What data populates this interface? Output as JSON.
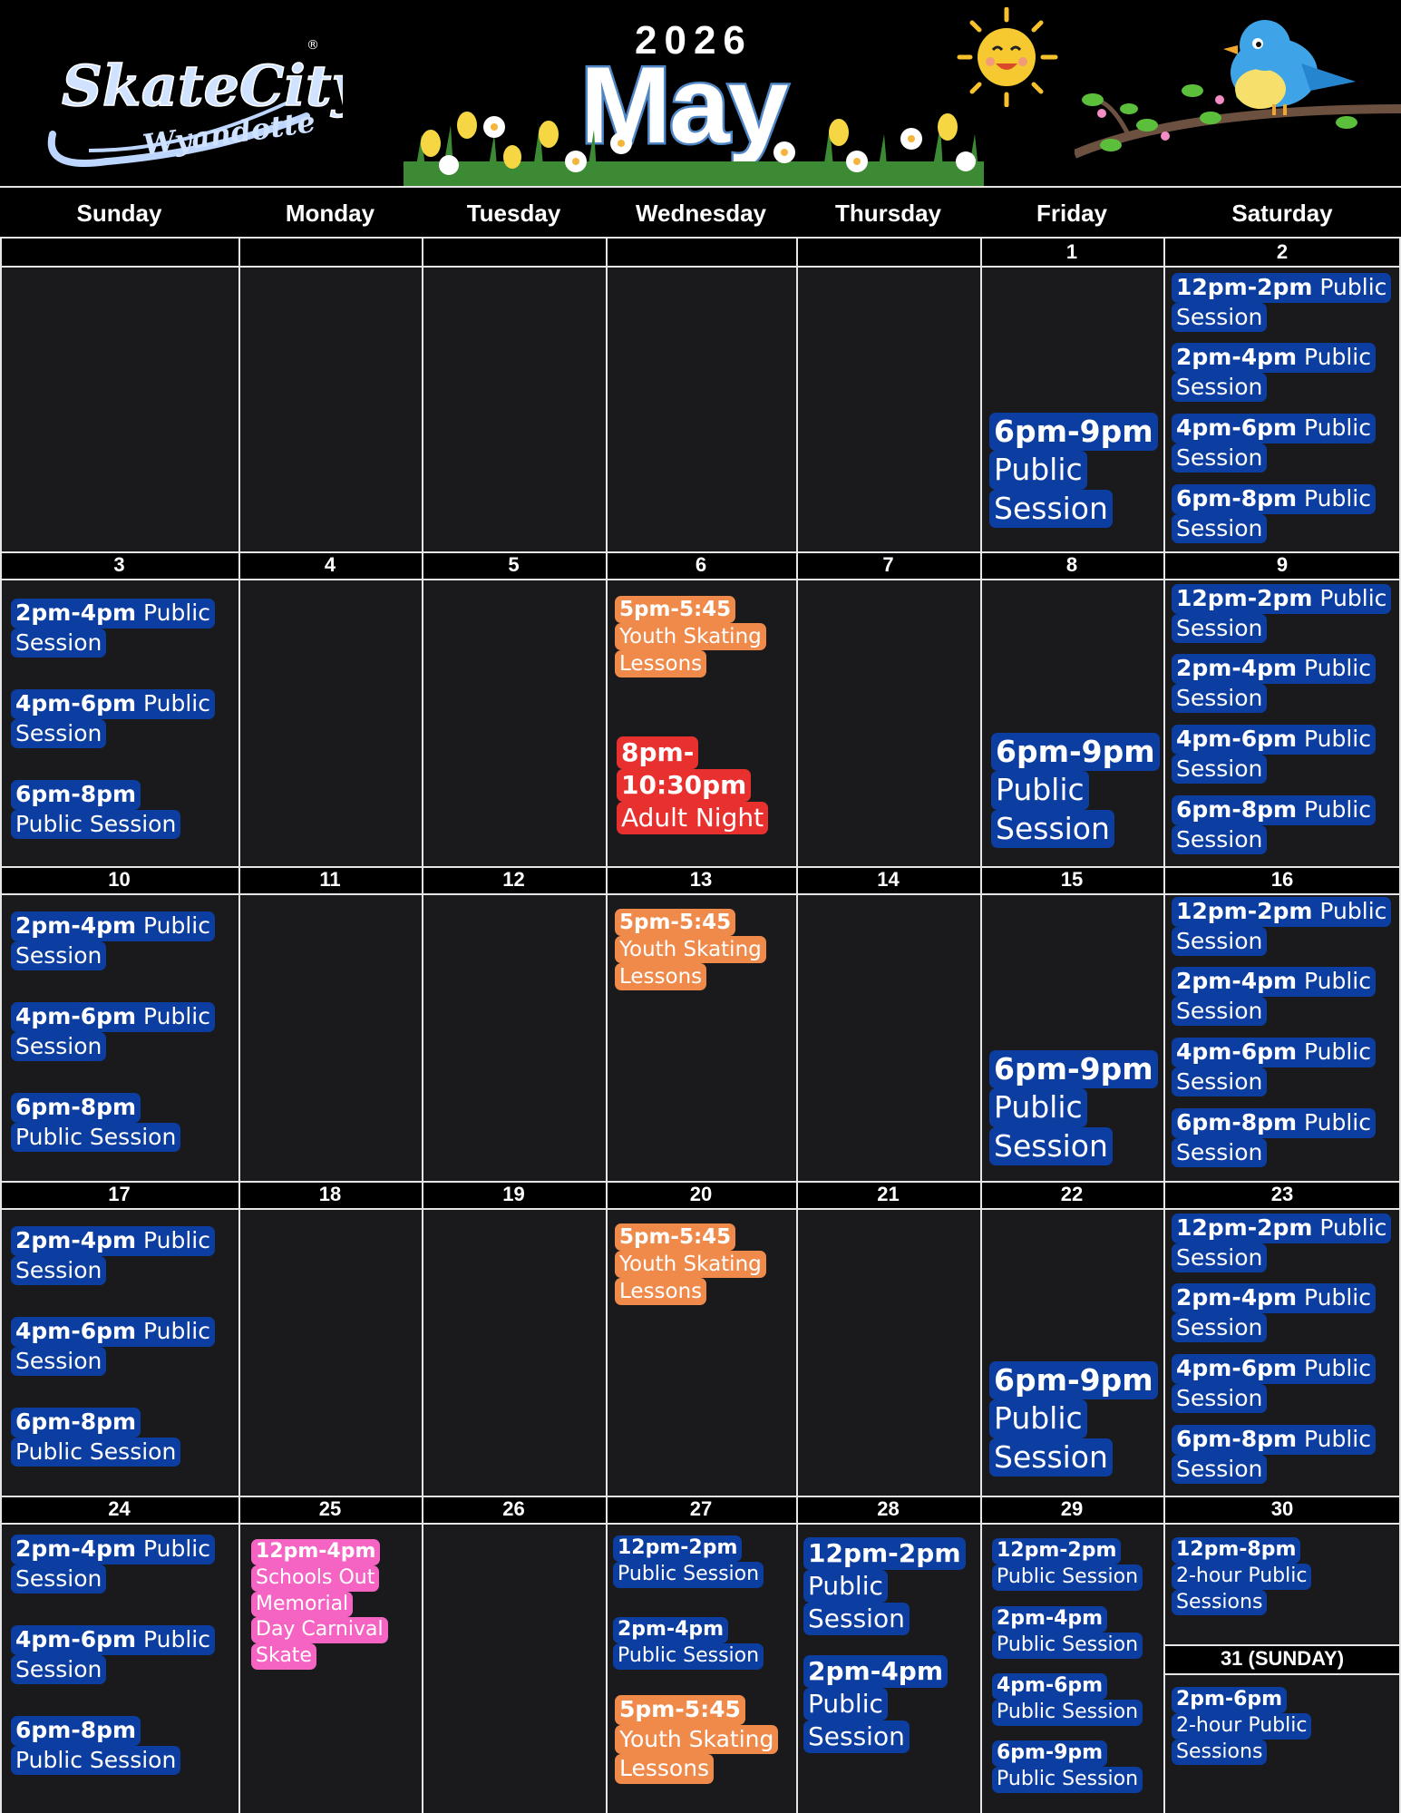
{
  "brand": {
    "name": "SkateCity",
    "location": "Wyandotte",
    "registered": "®"
  },
  "calendar": {
    "year": "2026",
    "month": "May"
  },
  "weekdays": [
    "Sunday",
    "Monday",
    "Tuesday",
    "Wednesday",
    "Thursday",
    "Friday",
    "Saturday"
  ],
  "weeks": [
    {
      "days": [
        "",
        "",
        "",
        "",
        "",
        "1",
        "2"
      ]
    },
    {
      "days": [
        "3",
        "4",
        "5",
        "6",
        "7",
        "8",
        "9"
      ]
    },
    {
      "days": [
        "10",
        "11",
        "12",
        "13",
        "14",
        "15",
        "16"
      ]
    },
    {
      "days": [
        "17",
        "18",
        "19",
        "20",
        "21",
        "22",
        "23"
      ]
    },
    {
      "days": [
        "24",
        "25",
        "26",
        "27",
        "28",
        "29",
        "30"
      ]
    }
  ],
  "extra_day_label": "31 (SUNDAY)",
  "events": {
    "sat_public": [
      {
        "time": "12pm-2pm",
        "rest": "Public",
        "line2": "Session"
      },
      {
        "time": "2pm-4pm",
        "rest": "Public",
        "line2": "Session"
      },
      {
        "time": "4pm-6pm",
        "rest": "Public",
        "line2": "Session"
      },
      {
        "time": "6pm-8pm",
        "rest": "Public",
        "line2": "Session"
      }
    ],
    "fri_public": {
      "time": "6pm-9pm",
      "line2": "Public",
      "line3": "Session"
    },
    "sun_public": [
      {
        "time": "2pm-4pm",
        "rest": "Public",
        "line2": "Session"
      },
      {
        "time": "4pm-6pm",
        "rest": "Public",
        "line2": "Session"
      },
      {
        "time": "6pm-8pm",
        "line2": "Public Session"
      }
    ],
    "youth": {
      "time": "5pm-5:45",
      "line2": "Youth Skating",
      "line3": "Lessons"
    },
    "adult": {
      "time1": "8pm-",
      "time2": "10:30pm",
      "line3": "Adult Night"
    },
    "carnival": {
      "time": "12pm-4pm",
      "l2": "Schools Out",
      "l3": "Memorial",
      "l4": "Day Carnival",
      "l5": "Skate"
    },
    "wed27": [
      {
        "time": "12pm-2pm",
        "line2": "Public Session"
      },
      {
        "time": "2pm-4pm",
        "line2": "Public Session"
      },
      {
        "time": "5pm-5:45",
        "line2": "Youth Skating",
        "line3": "Lessons"
      }
    ],
    "thu28": [
      {
        "time": "12pm-2pm",
        "line2": "Public",
        "line3": "Session"
      },
      {
        "time": "2pm-4pm",
        "line2": "Public",
        "line3": "Session"
      }
    ],
    "fri29": [
      {
        "time": "12pm-2pm",
        "line2": "Public Session"
      },
      {
        "time": "2pm-4pm",
        "line2": "Public Session"
      },
      {
        "time": "4pm-6pm",
        "line2": "Public Session"
      },
      {
        "time": "6pm-9pm",
        "line2": "Public Session"
      }
    ],
    "sat30": {
      "time": "12pm-8pm",
      "line2": "2-hour Public",
      "line3": "Sessions"
    },
    "sun31": {
      "time": "2pm-6pm",
      "line2": "2-hour Public",
      "line3": "Sessions"
    }
  },
  "colors": {
    "public": "#0c3da0",
    "youth": "#f08a4b",
    "adult": "#e8312f",
    "carnival": "#f564c3",
    "bg": "#1a1a1c"
  }
}
